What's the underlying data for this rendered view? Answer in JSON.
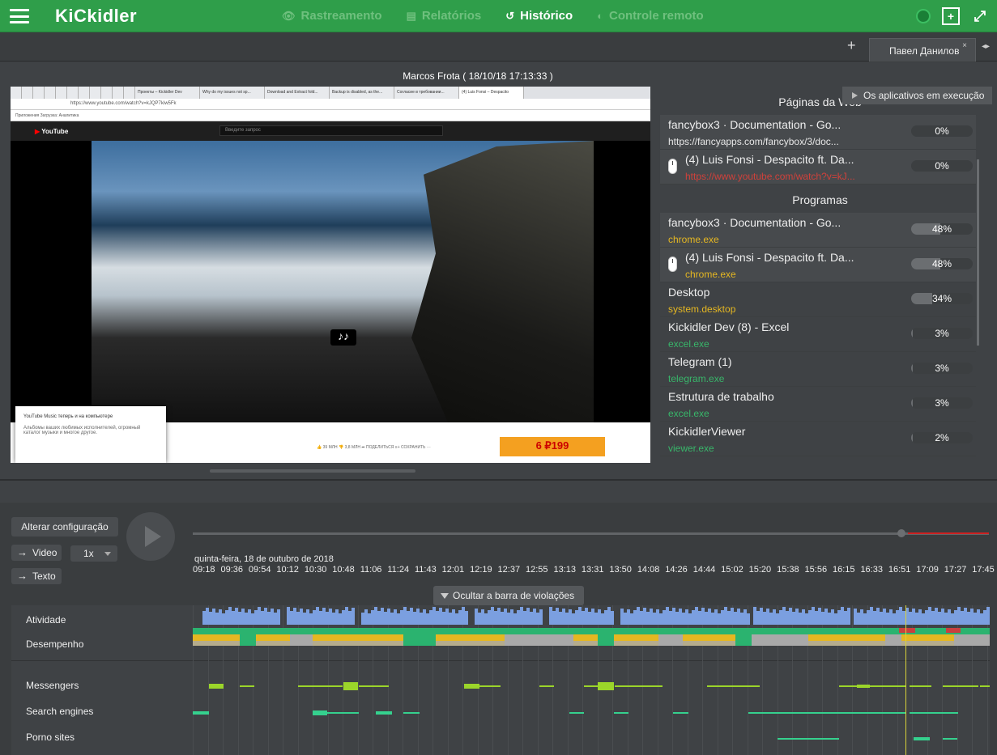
{
  "topbar": {
    "logo": "KiCkidler",
    "nav": [
      {
        "label": "Rastreamento",
        "icon": "eye-icon",
        "glyph": "👁",
        "active": false
      },
      {
        "label": "Relatórios",
        "icon": "document-icon",
        "glyph": "▤",
        "active": false
      },
      {
        "label": "Histórico",
        "icon": "history-icon",
        "glyph": "↺",
        "active": true
      },
      {
        "label": "Controle remoto",
        "icon": "remote-icon",
        "glyph": "◐",
        "active": false
      }
    ]
  },
  "tabs": {
    "add_glyph": "+",
    "user_tab": "Павел Данилов",
    "close_glyph": "×",
    "arrows_glyph": "◂▸"
  },
  "viewer": {
    "caption": "Marcos Frota  ( 18/10/18 17:13:33 )",
    "apps_button": "Os aplicativos em execução",
    "screenshot": {
      "chrome_tabs": [
        "",
        "",
        "",
        "",
        "",
        "",
        "",
        "",
        "",
        "",
        "",
        "Проекты – Kickidler Dev",
        "Why do my issues not sp...",
        "Download and Extract fold...",
        "Backup is disabled, as the...",
        "Согласие в требовании...",
        "(4) Luis Fonsi – Despacito"
      ],
      "url": "https://www.youtube.com/watch?v=kJQP7kiw5Fk",
      "bookmarks": "Приложения   Загрузка: Аналитика",
      "yt_logo": "YouTube",
      "yt_search_placeholder": "Введите запрос",
      "music_note": "♪♪",
      "popup_title": "YouTube Music теперь и на компьютере",
      "popup_text": "Альбомы ваших любимых исполнителей, огромный каталог музыки и многое другое.",
      "actions": "👍 39 МЛН   👎 3,8 МЛН   ➦ ПОДЕЛИТЬСЯ   ≡+ СОХРАНИТЬ   ···",
      "ad_text": "6 ₽199"
    },
    "web_title": "Páginas da Web",
    "web_pages": [
      {
        "title": "fancybox3 · Documentation - Go...",
        "url": "https://fancyapps.com/fancybox/3/doc...",
        "url_color": "white",
        "pct": "0%",
        "fill": 0,
        "mouse": false
      },
      {
        "title": "(4) Luis Fonsi - Despacito ft. Da...",
        "url": "https://www.youtube.com/watch?v=kJ...",
        "url_color": "red",
        "pct": "0%",
        "fill": 0,
        "mouse": true
      }
    ],
    "programs_title": "Programas",
    "programs": [
      {
        "title": "fancybox3 · Documentation - Go...",
        "exe": "chrome.exe",
        "color": "yellow",
        "pct": "48%",
        "fill": 0.48,
        "mouse": false,
        "shaded": true
      },
      {
        "title": "(4) Luis Fonsi - Despacito ft. Da...",
        "exe": "chrome.exe",
        "color": "yellow",
        "pct": "48%",
        "fill": 0.48,
        "mouse": true,
        "shaded": true
      },
      {
        "title": "Desktop",
        "exe": "system.desktop",
        "color": "yellow",
        "pct": "34%",
        "fill": 0.34,
        "mouse": false,
        "shaded": false
      },
      {
        "title": "Kickidler Dev (8) - Excel",
        "exe": "excel.exe",
        "color": "green",
        "pct": "3%",
        "fill": 0.03,
        "mouse": false,
        "shaded": false
      },
      {
        "title": "Telegram (1)",
        "exe": "telegram.exe",
        "color": "green",
        "pct": "3%",
        "fill": 0.03,
        "mouse": false,
        "shaded": false
      },
      {
        "title": "Estrutura de trabalho",
        "exe": "excel.exe",
        "color": "green",
        "pct": "3%",
        "fill": 0.03,
        "mouse": false,
        "shaded": false
      },
      {
        "title": "KickidlerViewer",
        "exe": "viewer.exe",
        "color": "green",
        "pct": "2%",
        "fill": 0.02,
        "mouse": false,
        "shaded": false
      }
    ]
  },
  "controls": {
    "config_button": "Alterar configuração",
    "video_button": "Video",
    "speed": "1x",
    "text_button": "Texto",
    "date": "quinta-feira, 18 de outubro de 2018",
    "times": [
      "09:18",
      "09:36",
      "09:54",
      "10:12",
      "10:30",
      "10:48",
      "11:06",
      "11:24",
      "11:43",
      "12:01",
      "12:19",
      "12:37",
      "12:55",
      "13:13",
      "13:31",
      "13:50",
      "14:08",
      "14:26",
      "14:44",
      "15:02",
      "15:20",
      "15:38",
      "15:56",
      "16:15",
      "16:33",
      "16:51",
      "17:09",
      "17:27",
      "17:45"
    ],
    "playback_position": 0.89,
    "violations_button": "Ocultar a barra de violações",
    "track_labels": {
      "activity": "Atividade",
      "performance": "Desempenho",
      "messengers": "Messengers",
      "search": "Search engines",
      "porn": "Porno sites"
    },
    "colors": {
      "activity": "#7b9fe0",
      "productive": "#2bb36f",
      "neutral": "#e5b722",
      "idle": "#a9a9a9",
      "violation": "#c94040",
      "messengers": "#9bd52a",
      "search": "#35d18e",
      "cursor": "#d9d33a"
    }
  }
}
